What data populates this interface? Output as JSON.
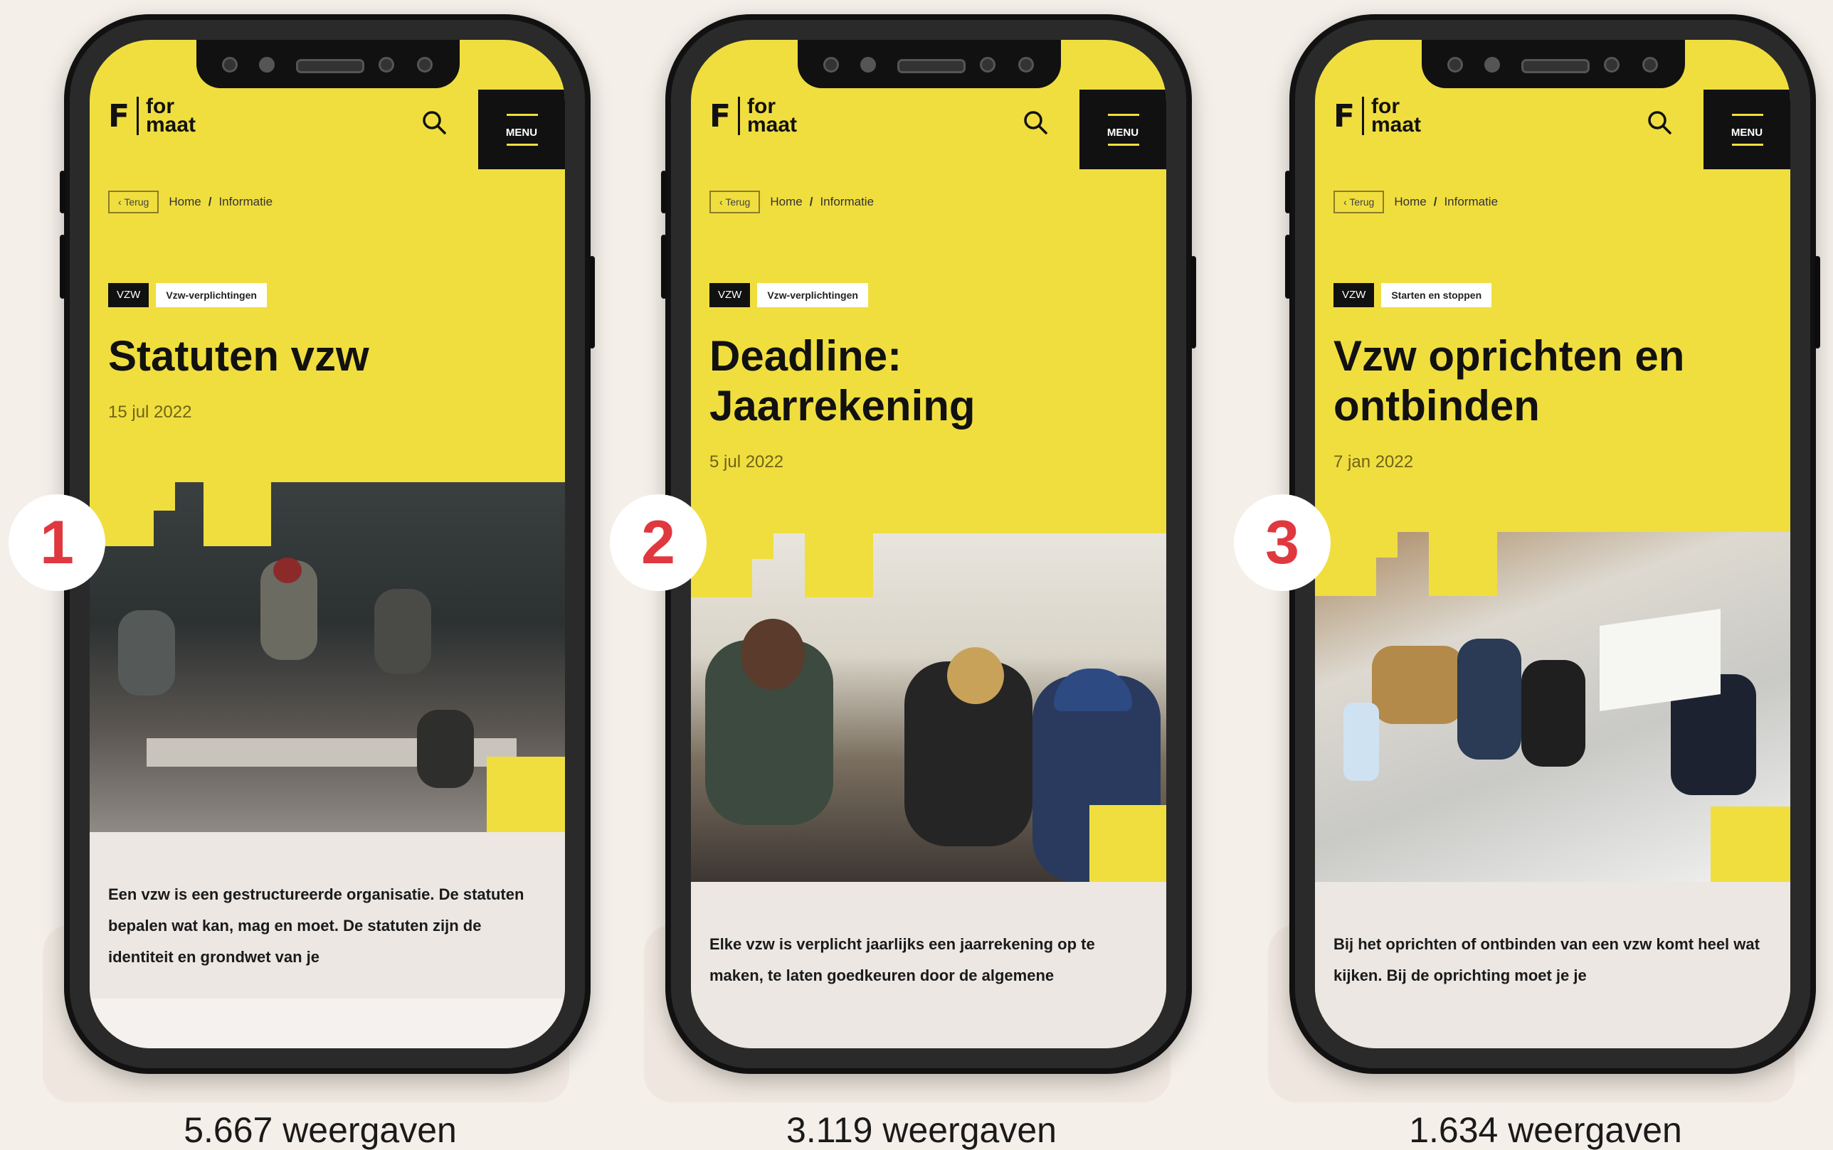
{
  "colors": {
    "background": "#f5efe9",
    "brand_yellow": "#f0de3f",
    "badge_red": "#e0383f",
    "phone_black": "#111111"
  },
  "app": {
    "logo_mark": "F",
    "logo_line1": "for",
    "logo_line2": "maat",
    "menu_label": "MENU",
    "back_label": "Terug",
    "crumb_home": "Home",
    "crumb_sep": "/",
    "crumb_current": "Informatie",
    "icons": [
      "search-icon",
      "menu-icon",
      "chevron-left-icon"
    ]
  },
  "cards": [
    {
      "rank": "1",
      "tag1": "VZW",
      "tag2": "Vzw-verplichtingen",
      "title": "Statuten vzw",
      "date": "15 jul 2022",
      "body": "Een vzw is een gestructureerde organisatie. De statuten bepalen wat kan, mag en moet. De statuten zijn de identiteit en grondwet van je",
      "views": "5.667 weergaven"
    },
    {
      "rank": "2",
      "tag1": "VZW",
      "tag2": "Vzw-verplichtingen",
      "title": "Deadline: Jaarrekening",
      "date": "5 jul 2022",
      "body": "Elke vzw is verplicht jaarlijks een jaarrekening op te maken, te laten goedkeuren door de algemene",
      "views": "3.119 weergaven"
    },
    {
      "rank": "3",
      "tag1": "VZW",
      "tag2": "Starten en stoppen",
      "title": "Vzw oprichten en ontbinden",
      "date": "7 jan 2022",
      "body": "Bij het oprichten of ontbinden van een vzw komt heel wat kijken. Bij de oprichting moet je je",
      "views": "1.634 weergaven"
    }
  ]
}
